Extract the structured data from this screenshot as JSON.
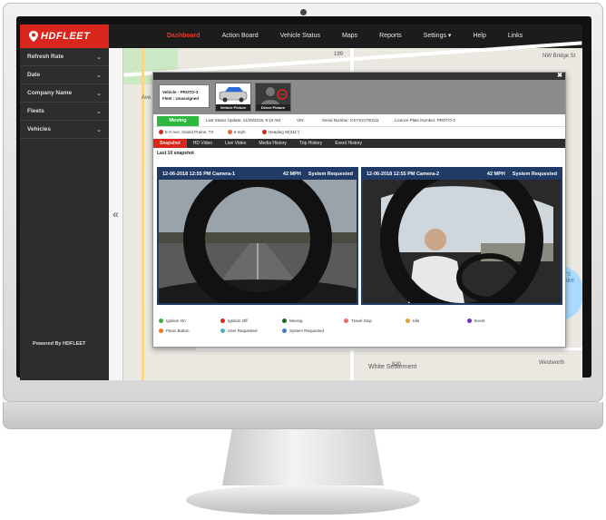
{
  "app": {
    "brand": "HDFLEET"
  },
  "nav": {
    "items": [
      "Dashboard",
      "Action Board",
      "Vehicle Status",
      "Maps",
      "Reports",
      "Settings ▾",
      "Help",
      "Links"
    ],
    "active_index": 0
  },
  "sidebar": {
    "items": [
      "Refresh Rate",
      "Date",
      "Company Name",
      "Fleets",
      "Vehicles"
    ],
    "footer": "Powered By HDFLEET",
    "collapse_glyph": "«"
  },
  "map": {
    "labels": [
      "White Settlement",
      "Westworth",
      "er's Lake",
      "Ave",
      "NW Bridge St",
      "199",
      "820"
    ]
  },
  "modal": {
    "close_glyph": "✖",
    "vehicle_label": "Vehicle : PROTO-3",
    "fleet_label": "Fleet : Unassigned",
    "vehicle_picture_caption": "Vehicle Picture",
    "driver_picture_caption": "Driver Picture",
    "status": "Moving",
    "last_status_update": "Last Status Update: 11/29/2018, 9:10 AM",
    "vin": "VIN:",
    "serial_number": "Serial Number: KSYS21700111",
    "licence_plate": "Licence Plate Number: PROTO-3",
    "address": "E K Ave, Grand Prairie, TX",
    "speed": "8 mph",
    "heading": "Heading W(311°)",
    "tabs": [
      "Snapshot",
      "HD Video",
      "Live Video",
      "Media History",
      "Trip History",
      "Event History"
    ],
    "active_tab": 0,
    "snapshot_title": "Last 10 snapshot",
    "cameras": [
      {
        "timestamp": "12-06-2018 12:55 PM Camera-1",
        "speed": "42 MPH",
        "trigger": "System Requested"
      },
      {
        "timestamp": "12-06-2018 12:55 PM Camera-2",
        "speed": "42 MPH",
        "trigger": "System Requested"
      }
    ],
    "legend": [
      {
        "label": "Ignition On",
        "color": "#3cb043"
      },
      {
        "label": "Ignition Off",
        "color": "#d9261c"
      },
      {
        "label": "Moving",
        "color": "#1a6b1a"
      },
      {
        "label": "Travel Stop",
        "color": "#e86a6a"
      },
      {
        "label": "Idle",
        "color": "#e0a030"
      },
      {
        "label": "Event",
        "color": "#7a2ad9"
      },
      {
        "label": "Panic Button",
        "color": "#f07a1a"
      },
      {
        "label": "User Requested",
        "color": "#4ab0c0"
      },
      {
        "label": "System Requested",
        "color": "#3a7ad9"
      }
    ]
  }
}
